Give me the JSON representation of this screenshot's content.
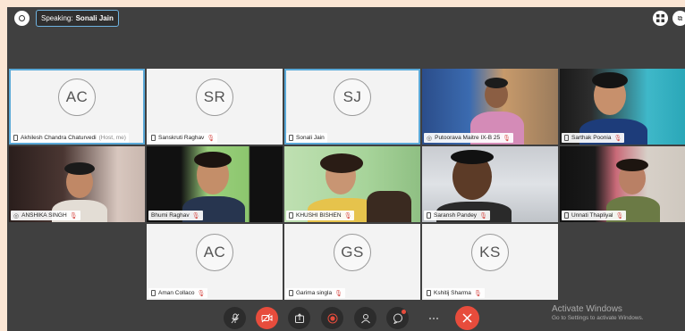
{
  "header": {
    "speaking_prefix": "Speaking:",
    "speaking_name": "Sonali Jain"
  },
  "participants": [
    {
      "initials": "AC",
      "name": "Akhilesh Chandra Chaturvedi",
      "suffix": "(Host, me)"
    },
    {
      "initials": "SR",
      "name": "Sanskruti Raghav"
    },
    {
      "initials": "SJ",
      "name": "Sonali Jain"
    },
    {
      "name": "Putoorava Maitre IX-B 25"
    },
    {
      "name": "Sarthak Poonia"
    },
    {
      "name": "ANSHIKA SINGH"
    },
    {
      "name": "Bhumi Raghav"
    },
    {
      "name": "KHUSHI BISHEN"
    },
    {
      "name": "Saransh Pandey"
    },
    {
      "name": "Unnati Thapliyal"
    },
    {
      "initials": "AC",
      "name": "Aman Collaco"
    },
    {
      "initials": "GS",
      "name": "Garima singla"
    },
    {
      "initials": "KS",
      "name": "Kshitij Sharma"
    }
  ],
  "watermark": {
    "title": "Activate Windows",
    "subtitle": "Go to Settings to activate Windows."
  },
  "colors": {
    "accent": "#5aa9d8",
    "danger": "#e74c3c",
    "stage": "#404040",
    "frame": "#fbe6d4"
  },
  "icons": [
    "info-icon",
    "grid-icon",
    "link-icon",
    "mic-off-icon",
    "video-off-icon",
    "share-icon",
    "record-icon",
    "participants-icon",
    "chat-icon",
    "more-icon",
    "close-icon"
  ]
}
